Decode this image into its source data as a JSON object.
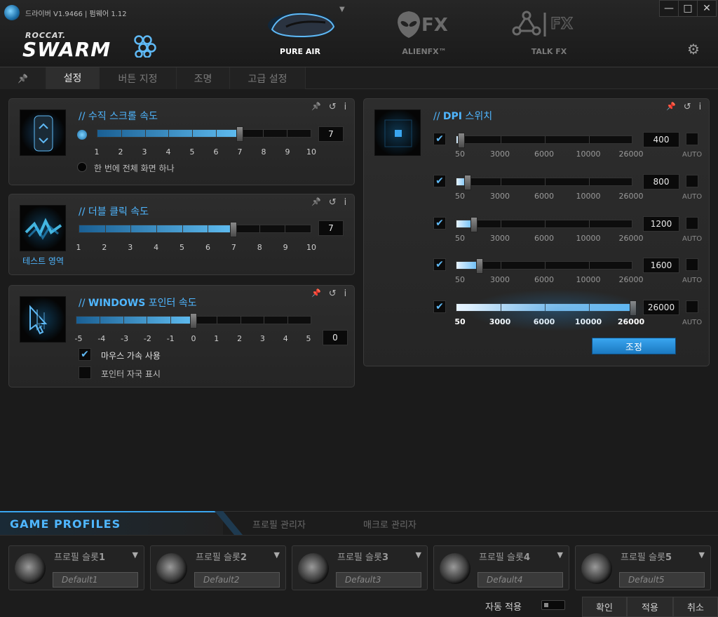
{
  "window": {
    "title": "드라이버 V1.9466 | 펌웨어 1.12",
    "minimize": "—",
    "maximize": "□",
    "close": "✕"
  },
  "brand": {
    "roccat": "ROCCAT.",
    "swarm": "SWARM"
  },
  "devices": [
    {
      "label": "PURE AIR"
    },
    {
      "label": "ALIENFX™"
    },
    {
      "label": "TALK FX"
    }
  ],
  "alienfx_logo": "FX",
  "talkfx_logo": "FX",
  "tabs": [
    {
      "label": "설정"
    },
    {
      "label": "버튼 지정"
    },
    {
      "label": "조명"
    },
    {
      "label": "고급 설정"
    }
  ],
  "panel_icons": {
    "pin": "📌",
    "reset": "↺",
    "info": "i"
  },
  "scroll": {
    "title_prefix": "// ",
    "title": "수직 스크롤 속도",
    "ticks": [
      "1",
      "2",
      "3",
      "4",
      "5",
      "6",
      "7",
      "8",
      "9",
      "10"
    ],
    "value": "7",
    "level": 7,
    "option_fullscreen": "한 번에 전체 화면 하나"
  },
  "dblclick": {
    "title_prefix": "// ",
    "title": "더블 클릭 속도",
    "ticks": [
      "1",
      "2",
      "3",
      "4",
      "5",
      "6",
      "7",
      "8",
      "9",
      "10"
    ],
    "value": "7",
    "level": 7,
    "test_area": "테스트 영역"
  },
  "pointer": {
    "title_prefix": "// ",
    "title_bold": "WINDOWS",
    "title": " 포인터 속도",
    "ticks": [
      "-5",
      "-4",
      "-3",
      "-2",
      "-1",
      "0",
      "1",
      "2",
      "3",
      "4",
      "5"
    ],
    "value": "0",
    "level": 0,
    "accel_label": "마우스 가속 사용",
    "accel_checked": true,
    "trail_label": "포인터 자국 표시",
    "trail_checked": false
  },
  "dpi": {
    "title_prefix": "// ",
    "title_bold": "DPI",
    "title": " 스위치",
    "ticks": [
      "50",
      "3000",
      "6000",
      "10000",
      "26000"
    ],
    "auto": "AUTO",
    "rows": [
      {
        "value": "400",
        "dpi": 400,
        "checked": true
      },
      {
        "value": "800",
        "dpi": 800,
        "checked": true
      },
      {
        "value": "1200",
        "dpi": 1200,
        "checked": true
      },
      {
        "value": "1600",
        "dpi": 1600,
        "checked": true
      },
      {
        "value": "26000",
        "dpi": 26000,
        "checked": true
      }
    ],
    "adjust_button": "조정"
  },
  "bottom": {
    "game_profiles": "GAME PROFILES",
    "profile_manager": "프로필 관리자",
    "macro_manager": "매크로 관리자",
    "profiles": [
      {
        "label": "프로필 슬롯",
        "num": "1",
        "value": "Default1",
        "active": true
      },
      {
        "label": "프로필 슬롯",
        "num": "2",
        "value": "Default2",
        "active": false
      },
      {
        "label": "프로필 슬롯",
        "num": "3",
        "value": "Default3",
        "active": false
      },
      {
        "label": "프로필 슬롯",
        "num": "4",
        "value": "Default4",
        "active": false
      },
      {
        "label": "프로필 슬롯",
        "num": "5",
        "value": "Default5",
        "active": false
      }
    ],
    "auto_apply": "자동 적용",
    "ok": "확인",
    "apply": "적용",
    "cancel": "취소"
  },
  "colors": {
    "accent": "#4fb6ff",
    "background": "#1b1b1b",
    "panel": "#2a2a2a"
  }
}
